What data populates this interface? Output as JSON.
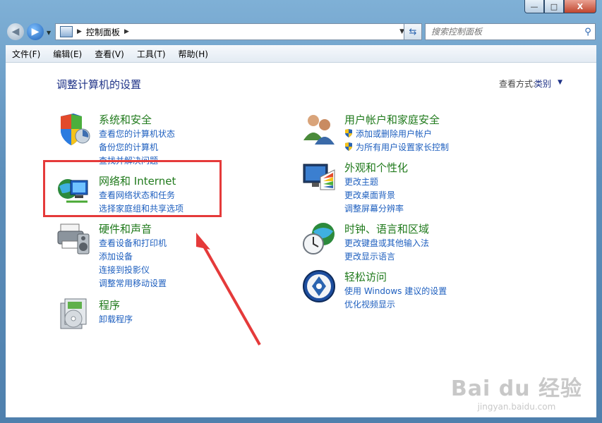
{
  "window": {
    "controls": {
      "minimize": "—",
      "maximize": "□",
      "close": "X"
    }
  },
  "nav": {
    "back_icon": "back-arrow-icon",
    "forward_icon": "forward-arrow-icon",
    "address_crumb": "控制面板",
    "search_placeholder": "搜索控制面板"
  },
  "menu": [
    "文件(F)",
    "编辑(E)",
    "查看(V)",
    "工具(T)",
    "帮助(H)"
  ],
  "page": {
    "heading": "调整计算机的设置",
    "view_by_label": "查看方式:",
    "view_by_value": "类别"
  },
  "categories": [
    {
      "title": "系统和安全",
      "icon": "shield-icon",
      "links": [
        "查看您的计算机状态",
        "备份您的计算机",
        "查找并解决问题"
      ]
    },
    {
      "title": "网络和 Internet",
      "icon": "network-globe-icon",
      "links": [
        "查看网络状态和任务",
        "选择家庭组和共享选项"
      ]
    },
    {
      "title": "硬件和声音",
      "icon": "printer-speaker-icon",
      "links": [
        "查看设备和打印机",
        "添加设备",
        "连接到投影仪",
        "调整常用移动设置"
      ]
    },
    {
      "title": "程序",
      "icon": "programs-disc-icon",
      "links": [
        "卸载程序"
      ]
    },
    {
      "title": "用户帐户和家庭安全",
      "icon": "users-icon",
      "links": [
        "添加或删除用户帐户",
        "为所有用户设置家长控制"
      ]
    },
    {
      "title": "外观和个性化",
      "icon": "monitor-palette-icon",
      "links": [
        "更改主题",
        "更改桌面背景",
        "调整屏幕分辨率"
      ]
    },
    {
      "title": "时钟、语言和区域",
      "icon": "clock-globe-icon",
      "links": [
        "更改键盘或其他输入法",
        "更改显示语言"
      ]
    },
    {
      "title": "轻松访问",
      "icon": "accessibility-icon",
      "links": [
        "使用 Windows 建议的设置",
        "优化视频显示"
      ]
    }
  ],
  "watermark": {
    "line1": "Bai du 经验",
    "line2": "jingyan.baidu.com"
  },
  "colors": {
    "category_title": "#207a1c",
    "link": "#1e5fbf",
    "heading": "#1e3287",
    "highlight": "#e53a3a"
  }
}
